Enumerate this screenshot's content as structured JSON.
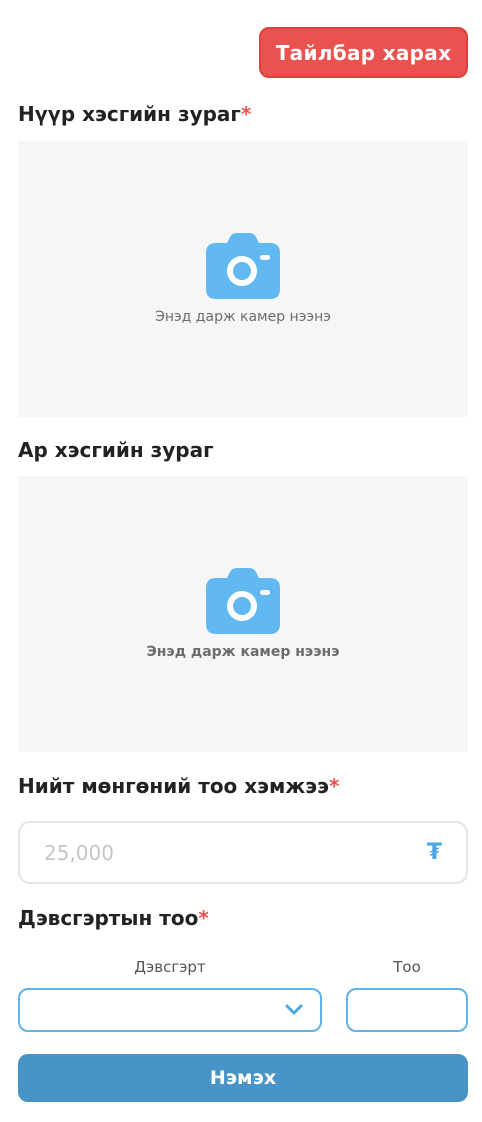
{
  "header": {
    "help_button": "Тайлбар харах"
  },
  "front_photo": {
    "title": "Нүүр хэсгийн зураг",
    "required_mark": "*",
    "hint": "Энэд дарж камер нээнэ",
    "icon": "camera-icon"
  },
  "back_photo": {
    "title": "Ар хэсгийн зураг",
    "hint": "Энэд дарж камер нээнэ",
    "icon": "camera-icon"
  },
  "total_amount": {
    "title": "Нийт мөнгөний тоо хэмжээ",
    "required_mark": "*",
    "placeholder": "25,000",
    "currency_symbol": "₮"
  },
  "denominations": {
    "title": "Дэвсгэртын тоо",
    "required_mark": "*",
    "denomination_label": "Дэвсгэрт",
    "count_label": "Тоо",
    "add_button": "Нэмэх"
  },
  "colors": {
    "danger": "#e9524f",
    "accent_blue": "#5fb3ea",
    "button_blue": "#4894c6",
    "camera_blue": "#62b9f2"
  }
}
